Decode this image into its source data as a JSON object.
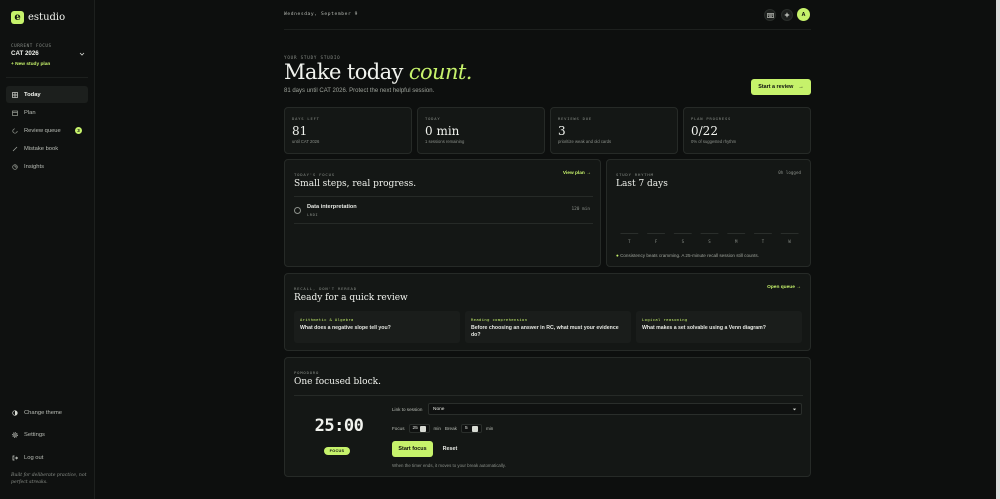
{
  "brand": {
    "mark": "e",
    "name": "estudio"
  },
  "sidebar": {
    "current_focus_label": "CURRENT FOCUS",
    "current_focus_value": "CAT 2026",
    "new_plan": "+ New study plan",
    "items": [
      {
        "label": "Today",
        "icon": "grid-icon",
        "active": true
      },
      {
        "label": "Plan",
        "icon": "calendar-icon"
      },
      {
        "label": "Review queue",
        "icon": "refresh-icon",
        "badge": "3"
      },
      {
        "label": "Mistake book",
        "icon": "pen-icon"
      },
      {
        "label": "Insights",
        "icon": "pie-icon"
      }
    ],
    "bottom_items": [
      {
        "label": "Change theme",
        "icon": "half-circle-icon"
      },
      {
        "label": "Settings",
        "icon": "gear-icon"
      },
      {
        "label": "Log out",
        "icon": "logout-icon"
      }
    ],
    "footer": "Built for deliberate practice, not perfect streaks."
  },
  "header": {
    "date": "Wednesday, September 9",
    "avatar": "A"
  },
  "hero": {
    "eyebrow": "YOUR STUDY STUDIO",
    "title_main": "Make today ",
    "title_accent": "count.",
    "subtitle": "81 days until CAT 2026. Protect the next helpful session.",
    "cta": "Start a review",
    "cta_arrow": "→"
  },
  "stats": [
    {
      "label": "DAYS LEFT",
      "value": "81",
      "sub": "until CAT 2026"
    },
    {
      "label": "TODAY",
      "value": "0 min",
      "sub": "1 sessions remaining"
    },
    {
      "label": "REVIEWS DUE",
      "value": "3",
      "sub": "prioritize weak and old cards"
    },
    {
      "label": "PLAN PROGRESS",
      "value": "0/22",
      "sub": "0% of suggested rhythm"
    }
  ],
  "focus": {
    "eyebrow": "TODAY'S FOCUS",
    "title": "Small steps, real progress.",
    "link": "View plan →",
    "task": {
      "title": "Data interpretation",
      "tag": "LRDI",
      "duration": "120 min"
    }
  },
  "rhythm": {
    "eyebrow": "STUDY RHYTHM",
    "title": "Last 7 days",
    "logged": "0h logged",
    "note": "Consistency beats cramming. A 25-minute recall session still counts.",
    "note_dot": "●"
  },
  "chart_data": {
    "type": "bar",
    "categories": [
      "T",
      "F",
      "S",
      "S",
      "M",
      "T",
      "W"
    ],
    "values": [
      0,
      0,
      0,
      0,
      0,
      0,
      0
    ],
    "title": "Last 7 days",
    "xlabel": "",
    "ylabel": ""
  },
  "recall": {
    "eyebrow": "RECALL, DON'T REREAD",
    "title": "Ready for a quick review",
    "link": "Open queue →",
    "items": [
      {
        "category": "Arithmetic & Algebra",
        "question": "What does a negative slope tell you?"
      },
      {
        "category": "Reading comprehension",
        "question": "Before choosing an answer in RC, what must your evidence do?"
      },
      {
        "category": "Logical reasoning",
        "question": "What makes a set solvable using a Venn diagram?"
      }
    ]
  },
  "pomodoro": {
    "eyebrow": "POMODORO",
    "title": "One focused block.",
    "timer": "25:00",
    "mode": "FOCUS",
    "link_label": "Link to session",
    "link_value": "None",
    "focus_label": "Focus",
    "focus_value": "25",
    "break_label": "Break",
    "break_value": "5",
    "unit": "min",
    "start": "Start focus",
    "reset": "Reset",
    "note": "When the timer ends, it moves to your break automatically."
  }
}
